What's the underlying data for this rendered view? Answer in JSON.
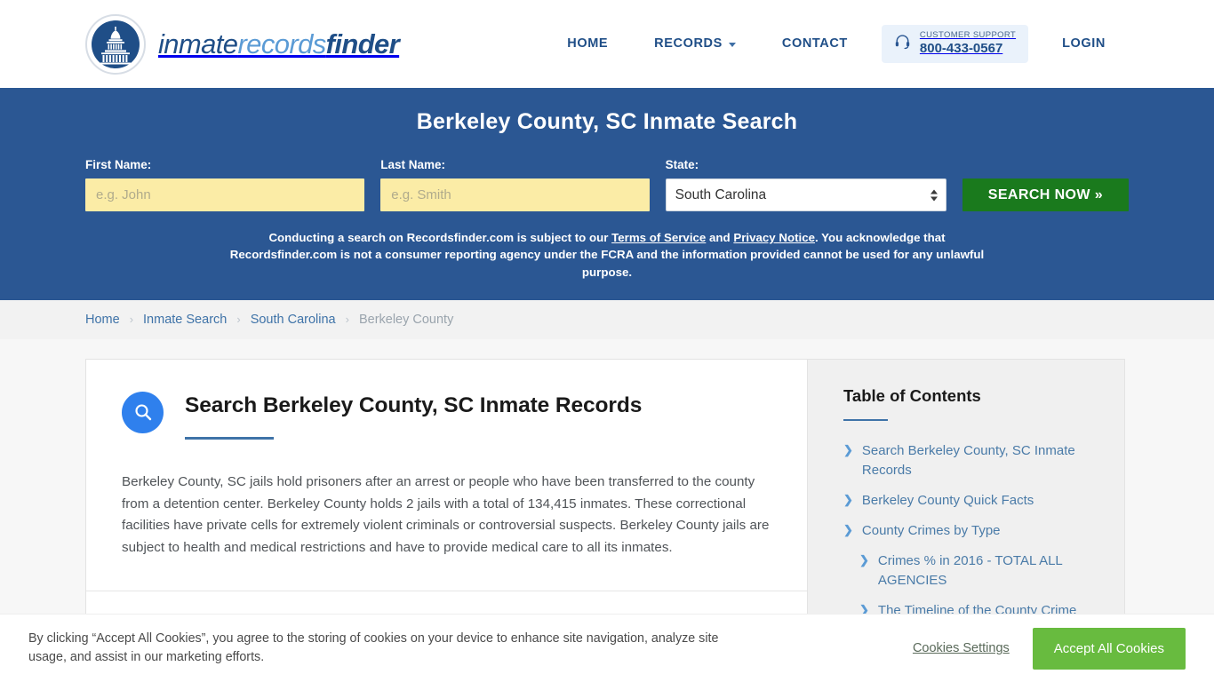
{
  "brand": {
    "logo_icon": "capitol-dome-icon",
    "word_1": "inmate",
    "word_2": "records",
    "word_3": "finder"
  },
  "nav": {
    "home": "HOME",
    "records": "RECORDS",
    "contact": "CONTACT",
    "login": "LOGIN",
    "support_label": "CUSTOMER SUPPORT",
    "support_phone": "800-433-0567",
    "support_icon": "headset-icon",
    "records_caret_icon": "chevron-down-icon"
  },
  "hero": {
    "title": "Berkeley County, SC Inmate Search",
    "first_name_label": "First Name:",
    "first_name_value": "",
    "first_name_placeholder": "e.g. John",
    "last_name_label": "Last Name:",
    "last_name_value": "",
    "last_name_placeholder": "e.g. Smith",
    "state_label": "State:",
    "state_value": "South Carolina",
    "state_options": [
      "South Carolina"
    ],
    "search_button": "SEARCH NOW »",
    "disclaimer_1": "Conducting a search on Recordsfinder.com is subject to our ",
    "disclaimer_link_1": "Terms of Service",
    "disclaimer_2": " and ",
    "disclaimer_link_2": "Privacy Notice",
    "disclaimer_3": ". You acknowledge that Recordsfinder.com is not a consumer reporting agency under the FCRA and the information provided cannot be used for any unlawful purpose."
  },
  "breadcrumb": {
    "items": [
      {
        "label": "Home",
        "current": false
      },
      {
        "label": "Inmate Search",
        "current": false
      },
      {
        "label": "South Carolina",
        "current": false
      },
      {
        "label": "Berkeley County",
        "current": true
      }
    ],
    "separator": "›"
  },
  "main": {
    "heading_icon": "search-icon",
    "heading": "Search Berkeley County, SC Inmate Records",
    "paragraph": "Berkeley County, SC jails hold prisoners after an arrest or people who have been transferred to the county from a detention center. Berkeley County holds 2 jails with a total of 134,415 inmates. These correctional facilities have private cells for extremely violent criminals or controversial suspects. Berkeley County jails are subject to health and medical restrictions and have to provide medical care to all its inmates."
  },
  "toc": {
    "title": "Table of Contents",
    "arrow_icon": "chevron-right-icon",
    "items": [
      {
        "label": "Search Berkeley County, SC Inmate Records",
        "level": 1
      },
      {
        "label": "Berkeley County Quick Facts",
        "level": 1
      },
      {
        "label": "County Crimes by Type",
        "level": 1
      },
      {
        "label": "Crimes % in 2016 - TOTAL ALL AGENCIES",
        "level": 2
      },
      {
        "label": "The Timeline of the County Crime Trends",
        "level": 2
      }
    ]
  },
  "cookies": {
    "text": "By clicking “Accept All Cookies”, you agree to the storing of cookies on your device to enhance site navigation, analyze site usage, and assist in our marketing efforts.",
    "settings_label": "Cookies Settings",
    "accept_label": "Accept All Cookies"
  },
  "colors": {
    "hero_blue": "#2b5793",
    "brand_blue": "#1f4e87",
    "accent_blue": "#3f73a8",
    "search_green": "#1a7a1d",
    "cookie_green": "#68bb3f",
    "input_yellow": "#fbeca6",
    "sidebar_gray": "#f0f0f0"
  }
}
